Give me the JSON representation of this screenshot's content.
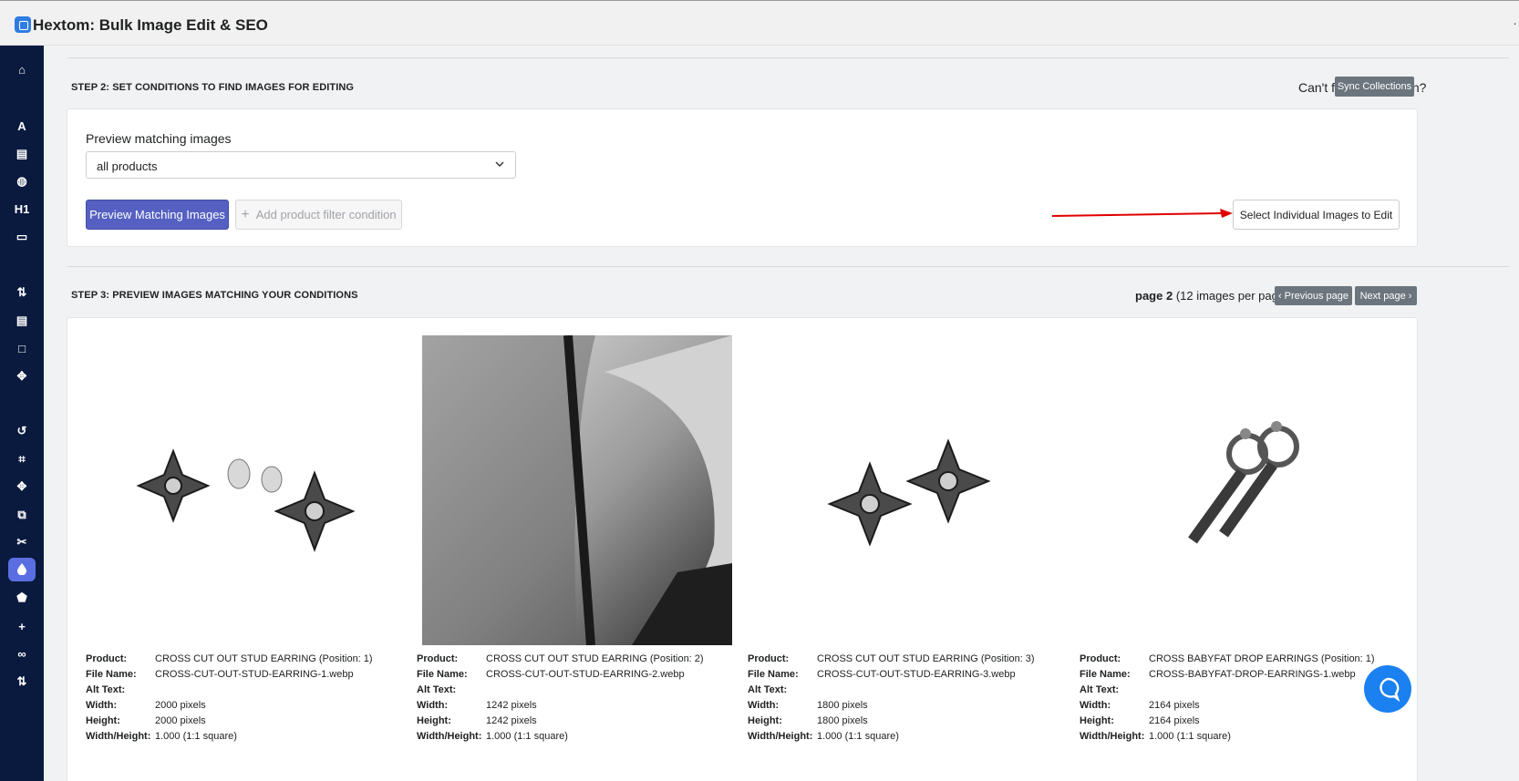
{
  "app": {
    "title": "Hextom: Bulk Image Edit & SEO"
  },
  "sidebar": {
    "items": [
      {
        "name": "home-icon",
        "glyph": "⌂"
      },
      {
        "name": "alt-text-icon",
        "glyph": "A"
      },
      {
        "name": "file-icon",
        "glyph": "▤"
      },
      {
        "name": "globe-icon",
        "glyph": "◍"
      },
      {
        "name": "heading-icon",
        "glyph": "H1"
      },
      {
        "name": "caption-icon",
        "glyph": "▭"
      },
      {
        "name": "sort-icon",
        "glyph": "⇅"
      },
      {
        "name": "image-file-icon",
        "glyph": "▤"
      },
      {
        "name": "square-icon",
        "glyph": "□"
      },
      {
        "name": "move-icon",
        "glyph": "✥"
      },
      {
        "name": "undo-icon",
        "glyph": "↺"
      },
      {
        "name": "crop-icon",
        "glyph": "⌗"
      },
      {
        "name": "arrows-icon",
        "glyph": "✥"
      },
      {
        "name": "resize-icon",
        "glyph": "⧉"
      },
      {
        "name": "scissors-icon",
        "glyph": "✂"
      },
      {
        "name": "drop-icon",
        "glyph": "💧"
      },
      {
        "name": "tag-icon",
        "glyph": "⬟"
      },
      {
        "name": "plus-icon",
        "glyph": "+"
      },
      {
        "name": "link-icon",
        "glyph": "∞"
      },
      {
        "name": "sort-alt-icon",
        "glyph": "⇅"
      }
    ]
  },
  "step2": {
    "title": "STEP 2: SET CONDITIONS TO FIND IMAGES FOR EDITING",
    "sync_question": "Can't find a collection?",
    "sync_button": "Sync Collections",
    "preview_label": "Preview matching images",
    "select_value": "all products",
    "preview_button": "Preview Matching Images",
    "add_filter_button": "Add product filter condition",
    "select_individual_button": "Select Individual Images to Edit"
  },
  "step3": {
    "title": "STEP 3: PREVIEW IMAGES MATCHING YOUR CONDITIONS",
    "page_label": "page 2",
    "per_page": "(12 images per page)",
    "prev_button": "Previous page",
    "next_button": "Next page"
  },
  "meta_labels": {
    "product": "Product:",
    "file_name": "File Name:",
    "alt_text": "Alt Text:",
    "width": "Width:",
    "height": "Height:",
    "ratio": "Width/Height:"
  },
  "images": [
    {
      "product": "CROSS CUT OUT STUD EARRING (Position: 1)",
      "file_name": "CROSS-CUT-OUT-STUD-EARRING-1.webp",
      "alt_text": "",
      "width": "2000 pixels",
      "height": "2000 pixels",
      "ratio": "1.000 (1:1 square)"
    },
    {
      "product": "CROSS CUT OUT STUD EARRING (Position: 2)",
      "file_name": "CROSS-CUT-OUT-STUD-EARRING-2.webp",
      "alt_text": "",
      "width": "1242 pixels",
      "height": "1242 pixels",
      "ratio": "1.000 (1:1 square)"
    },
    {
      "product": "CROSS CUT OUT STUD EARRING (Position: 3)",
      "file_name": "CROSS-CUT-OUT-STUD-EARRING-3.webp",
      "alt_text": "",
      "width": "1800 pixels",
      "height": "1800 pixels",
      "ratio": "1.000 (1:1 square)"
    },
    {
      "product": "CROSS BABYFAT DROP EARRINGS (Position: 1)",
      "file_name": "CROSS-BABYFAT-DROP-EARRINGS-1.webp",
      "alt_text": "",
      "width": "2164 pixels",
      "height": "2164 pixels",
      "ratio": "1.000 (1:1 square)"
    }
  ],
  "colors": {
    "sidebar": "#0a1a3e",
    "primary": "#5560c2",
    "accent_active": "#5b6ee1",
    "help": "#1b80f0",
    "arrow": "#e00000"
  }
}
